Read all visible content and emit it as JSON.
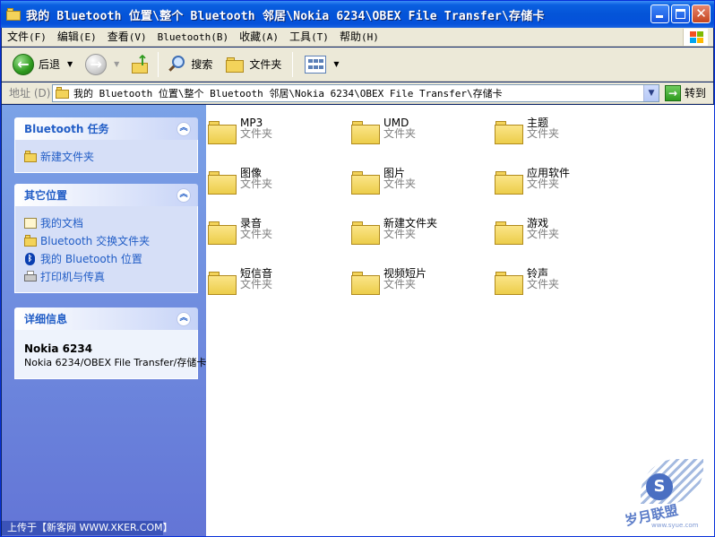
{
  "window": {
    "title": "我的 Bluetooth 位置\\整个 Bluetooth 邻居\\Nokia 6234\\OBEX File Transfer\\存储卡"
  },
  "menu": {
    "items": [
      {
        "label": "文件",
        "key": "(F)"
      },
      {
        "label": "编辑",
        "key": "(E)"
      },
      {
        "label": "查看",
        "key": "(V)"
      },
      {
        "label": "Bluetooth",
        "key": "(B)"
      },
      {
        "label": "收藏",
        "key": "(A)"
      },
      {
        "label": "工具",
        "key": "(T)"
      },
      {
        "label": "帮助",
        "key": "(H)"
      }
    ]
  },
  "toolbar": {
    "back_label": "后退",
    "search_label": "搜索",
    "folders_label": "文件夹"
  },
  "address": {
    "label": "地址 (D)",
    "value": "我的 Bluetooth 位置\\整个 Bluetooth 邻居\\Nokia 6234\\OBEX File Transfer\\存储卡",
    "go_label": "转到"
  },
  "sidebar": {
    "bluetooth_tasks": {
      "title": "Bluetooth 任务",
      "items": [
        "新建文件夹"
      ]
    },
    "other_places": {
      "title": "其它位置",
      "items": [
        "我的文档",
        "Bluetooth 交换文件夹",
        "我的 Bluetooth 位置",
        "打印机与传真"
      ]
    },
    "details": {
      "title": "详细信息",
      "name": "Nokia 6234",
      "path": "Nokia 6234/OBEX File Transfer/存储卡"
    },
    "footer": "上传于【新客网 WWW.XKER.COM】"
  },
  "folders": [
    {
      "name": "MP3",
      "type": "文件夹"
    },
    {
      "name": "UMD",
      "type": "文件夹"
    },
    {
      "name": "主题",
      "type": "文件夹"
    },
    {
      "name": "图像",
      "type": "文件夹"
    },
    {
      "name": "图片",
      "type": "文件夹"
    },
    {
      "name": "应用软件",
      "type": "文件夹"
    },
    {
      "name": "录音",
      "type": "文件夹"
    },
    {
      "name": "新建文件夹",
      "type": "文件夹"
    },
    {
      "name": "游戏",
      "type": "文件夹"
    },
    {
      "name": "短信音",
      "type": "文件夹"
    },
    {
      "name": "视频短片",
      "type": "文件夹"
    },
    {
      "name": "铃声",
      "type": "文件夹"
    }
  ],
  "watermark": {
    "text": "岁月联盟",
    "url": "www.syue.com"
  }
}
